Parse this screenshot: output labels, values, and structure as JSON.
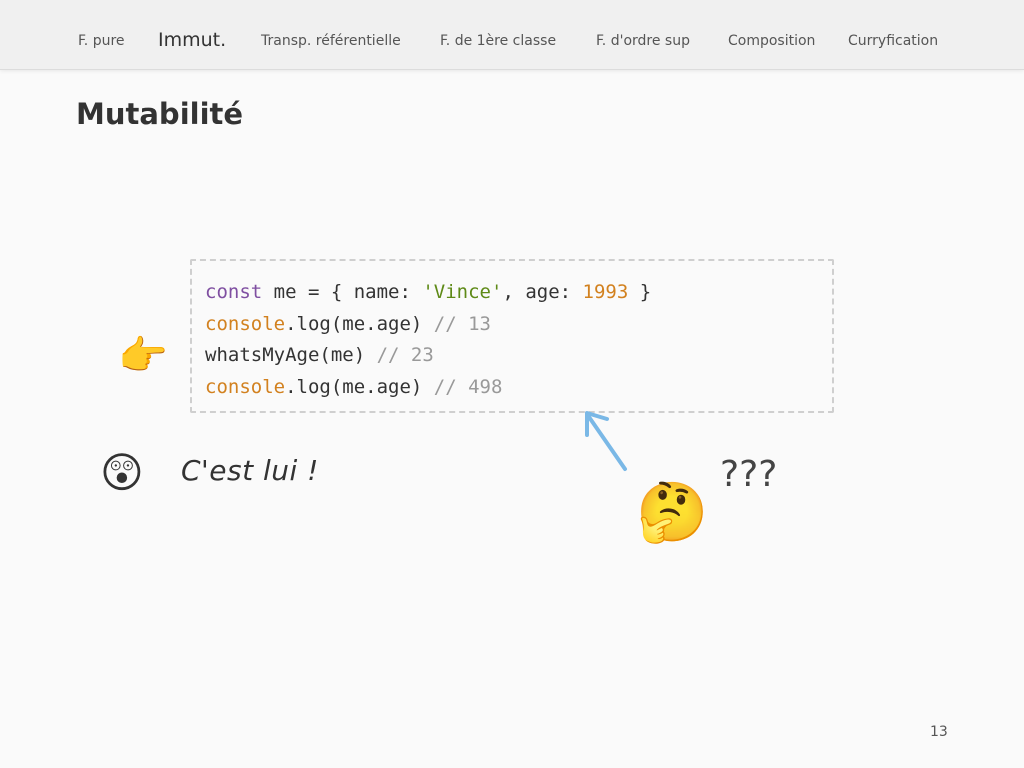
{
  "nav": {
    "items": [
      {
        "label": "F. pure",
        "active": false
      },
      {
        "label": "Immut.",
        "active": true
      },
      {
        "label": "Transp. référentielle",
        "active": false
      },
      {
        "label": "F. de 1ère classe",
        "active": false
      },
      {
        "label": "F. d'ordre sup",
        "active": false
      },
      {
        "label": "Composition",
        "active": false
      },
      {
        "label": "Curryfication",
        "active": false
      }
    ]
  },
  "slide": {
    "title": "Mutabilité",
    "code": {
      "line1": {
        "kw": "const",
        "t1": " me = { name: ",
        "str": "'Vince'",
        "t2": ", age: ",
        "num": "1993",
        "t3": " }"
      },
      "line2": {
        "fn": "console",
        "t1": ".log(me.age) ",
        "cmt": "// 13"
      },
      "line3": {
        "t1": "whatsMyAge(me) ",
        "cmt": "// 23"
      },
      "line4": {
        "fn": "console",
        "t1": ".log(me.age) ",
        "cmt": "// 498"
      }
    },
    "pointer_emoji": "👉",
    "astonished_emoji": "😲",
    "thinking_emoji": "🤔",
    "note": "C'est lui !",
    "question": "???",
    "page_number": "13"
  },
  "colors": {
    "keyword": "#7f4fa1",
    "function": "#d2811f",
    "string": "#5e8a17",
    "number": "#d2811f",
    "comment": "#999999",
    "arrow": "#7ab8e6"
  },
  "icons": {
    "pointer": "pointing-right-icon",
    "astonished": "astonished-face-icon",
    "thinking": "thinking-face-icon",
    "arrow": "arrow-up-left-icon"
  }
}
